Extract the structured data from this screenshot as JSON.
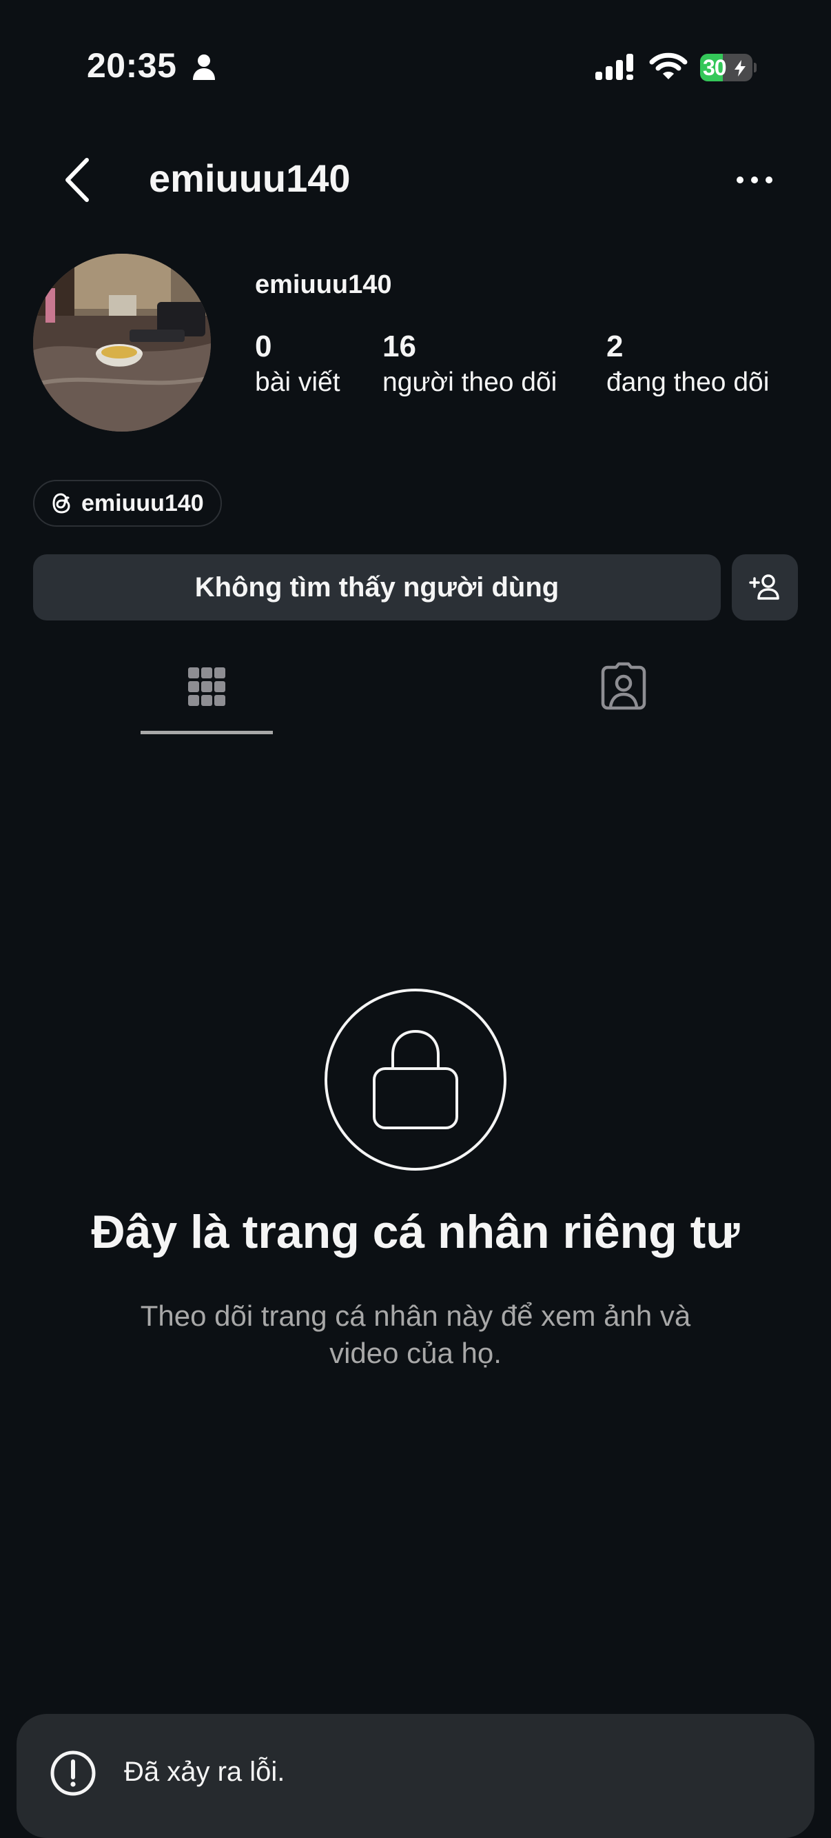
{
  "status_bar": {
    "time": "20:35",
    "battery_percent": "30",
    "battery_level": 0.3,
    "icons": [
      "person-icon",
      "signal-icon",
      "wifi-icon",
      "battery-charging-icon"
    ]
  },
  "header": {
    "title": "emiuuu140",
    "back_icon": "chevron-left-icon",
    "more_icon": "more-horizontal-icon"
  },
  "profile": {
    "name": "emiuuu140",
    "stats": [
      {
        "value": "0",
        "label": "bài viết"
      },
      {
        "value": "16",
        "label": "người theo dõi"
      },
      {
        "value": "2",
        "label": "đang theo dõi"
      }
    ],
    "threads_handle": "emiuuu140"
  },
  "actions": {
    "not_found_label": "Không tìm thấy người dùng",
    "add_user_icon": "add-person-icon"
  },
  "tabs": {
    "items": [
      "grid-icon",
      "tagged-person-icon"
    ],
    "active": 0
  },
  "private_notice": {
    "title": "Đây là trang cá nhân riêng tư",
    "description": "Theo dõi trang cá nhân này để xem ảnh và video của họ."
  },
  "toast": {
    "message": "Đã xảy ra lỗi.",
    "icon": "alert-circle-icon"
  },
  "colors": {
    "background": "#0c1014",
    "button": "#2b3036",
    "toast": "#262a2e",
    "battery_green": "#34c759",
    "muted_text": "#a8a8a8"
  }
}
